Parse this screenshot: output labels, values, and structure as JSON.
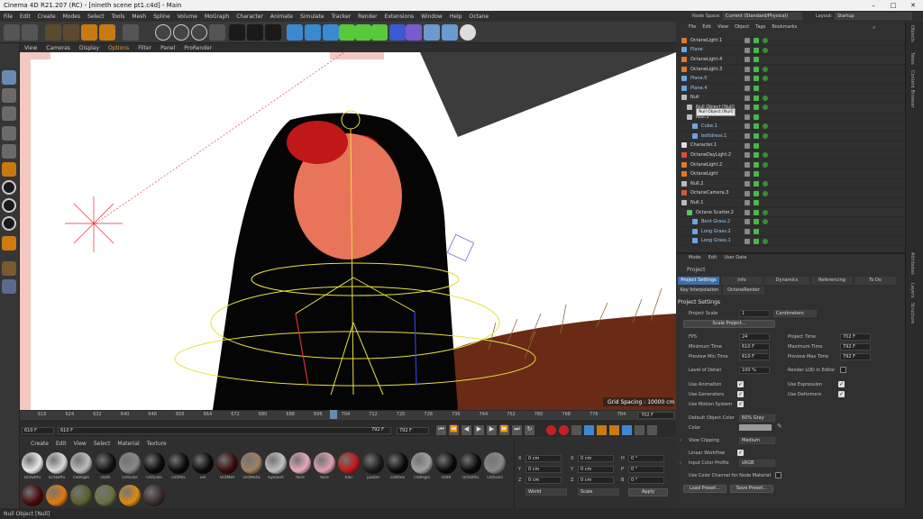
{
  "window": {
    "title": "Cinema 4D R21.207 (RC) - [nineth scene pt1.c4d] - Main"
  },
  "menubar": [
    "File",
    "Edit",
    "Create",
    "Modes",
    "Select",
    "Tools",
    "Mesh",
    "Spline",
    "Volume",
    "MoGraph",
    "Character",
    "Animate",
    "Simulate",
    "Tracker",
    "Render",
    "Extensions",
    "Window",
    "Help",
    "Octane"
  ],
  "nodespace": {
    "label": "Node Space:",
    "value": "Current (Standard/Physical)",
    "layout_label": "Layout:",
    "layout_value": "Startup"
  },
  "viewport_menu": [
    "View",
    "Cameras",
    "Display",
    "Options",
    "Filter",
    "Panel",
    "ProRender"
  ],
  "viewport": {
    "grid_spacing": "Grid Spacing : 10000 cm"
  },
  "timeline": {
    "ticks": [
      "616",
      "624",
      "632",
      "640",
      "648",
      "656",
      "664",
      "672",
      "680",
      "688",
      "696",
      "704",
      "712",
      "720",
      "728",
      "736",
      "744",
      "752",
      "760",
      "768",
      "776",
      "784",
      "792"
    ],
    "current": "702 F",
    "start": "610 F",
    "min": "610 F",
    "max": "792 F",
    "end": "792 F"
  },
  "object_manager": {
    "menu": [
      "File",
      "Edit",
      "View",
      "Object",
      "Tags",
      "Bookmarks"
    ],
    "rows": [
      {
        "name": "OctaneLight.1",
        "color": "#e07a2a"
      },
      {
        "name": "Plane",
        "color": "#6aa6e0"
      },
      {
        "name": "OctaneLight.4",
        "color": "#e07a2a"
      },
      {
        "name": "OctaneLight.3",
        "color": "#e07a2a"
      },
      {
        "name": "Plane.5",
        "color": "#6aa6e0"
      },
      {
        "name": "Plane.4",
        "color": "#6aa6e0"
      },
      {
        "name": "Null",
        "color": "#bbbbbb"
      },
      {
        "name": "Null Object [Null]",
        "color": "#bbbbbb"
      },
      {
        "name": "Null.3",
        "color": "#bbbbbb"
      },
      {
        "name": "Cube.1",
        "color": "#6aa6e0"
      },
      {
        "name": "bottdress.1",
        "color": "#6aa6e0"
      },
      {
        "name": "Character.1",
        "color": "#dddddd"
      },
      {
        "name": "OctaneDayLight.2",
        "color": "#e04a3a"
      },
      {
        "name": "OctaneLight.2",
        "color": "#e07a2a"
      },
      {
        "name": "OctaneLight",
        "color": "#e07a2a"
      },
      {
        "name": "Null.2",
        "color": "#bbbbbb"
      },
      {
        "name": "OctaneCamera.3",
        "color": "#d45a3a"
      },
      {
        "name": "Null.1",
        "color": "#bbbbbb"
      },
      {
        "name": "Octane Scatter.2",
        "color": "#5ac85a"
      },
      {
        "name": "Bent Grass.2",
        "color": "#6aa6e0"
      },
      {
        "name": "Long Grass.2",
        "color": "#6aa6e0"
      },
      {
        "name": "Long Grass.1",
        "color": "#6aa6e0"
      }
    ]
  },
  "attributes": {
    "menu": [
      "Mode",
      "Edit",
      "User Data"
    ],
    "header": "Project",
    "tabs": [
      "Project Settings",
      "Info",
      "Dynamics",
      "Referencing",
      "To Do"
    ],
    "subtabs": [
      "Key Interpolation",
      "OctaneRender"
    ],
    "section": "Project Settings",
    "project_scale_label": "Project Scale",
    "project_scale": "1",
    "project_scale_unit": "Centimeters",
    "scale_project_btn": "Scale Project...",
    "fps_label": "FPS",
    "fps": "24",
    "project_time_label": "Project Time",
    "project_time": "702 F",
    "min_time_label": "Minimum Time",
    "min_time": "610 F",
    "max_time_label": "Maximum Time",
    "max_time": "792 F",
    "pmin_label": "Preview Min Time",
    "pmin": "610 F",
    "pmax_label": "Preview Max Time",
    "pmax": "792 F",
    "lod_label": "Level of Detail",
    "lod": "100 %",
    "render_lod_label": "Render LOD in Editor",
    "use_anim": "Use Animation",
    "use_expr": "Use Expression",
    "use_gen": "Use Generators",
    "use_def": "Use Deformers",
    "use_motion": "Use Motion System",
    "default_color_label": "Default Object Color",
    "default_color": "60% Gray",
    "color_label": "Color",
    "view_clip_label": "View Clipping",
    "view_clip": "Medium",
    "linear_label": "Linear Workflow",
    "profile_label": "Input Color Profile",
    "profile": "sRGB",
    "color_channel_label": "Use Color Channel for Node Material",
    "load_preset": "Load Preset...",
    "save_preset": "Save Preset..."
  },
  "right_dock_tabs": [
    "Objects",
    "Takes",
    "Content Browser",
    "Attributes",
    "Layers",
    "Structure"
  ],
  "materials": {
    "menu": [
      "Create",
      "Edit",
      "View",
      "Select",
      "Material",
      "Texture"
    ],
    "row1": [
      {
        "label": "OctDiffu",
        "color": "#e8e8e8"
      },
      {
        "label": "OctDiffu",
        "color": "#d8d8d8"
      },
      {
        "label": "clothglo",
        "color": "#bdbdbd"
      },
      {
        "label": "cloth",
        "color": "#111111"
      },
      {
        "label": "OctGlos",
        "color": "#888888"
      },
      {
        "label": "OctGlos",
        "color": "#0a0a0a"
      },
      {
        "label": "OctMix",
        "color": "#0a0a0a"
      },
      {
        "label": "vel",
        "color": "#0a0a0a"
      },
      {
        "label": "OctMet",
        "color": "#3a0c0c"
      },
      {
        "label": "OctMeta",
        "color": "#a08060"
      },
      {
        "label": "eyelash",
        "color": "#c0c0c0"
      },
      {
        "label": "face",
        "color": "#e8a8b8"
      },
      {
        "label": "face",
        "color": "#e0a0b0"
      },
      {
        "label": "hair",
        "color": "#c01818"
      },
      {
        "label": "pastel",
        "color": "#1a1a1a"
      },
      {
        "label": "clothes",
        "color": "#0a0a0a"
      },
      {
        "label": "clothglo",
        "color": "#a0a0a0"
      },
      {
        "label": "cloth",
        "color": "#0a0a0a"
      },
      {
        "label": "OctDiffu",
        "color": "#0a0a0a"
      },
      {
        "label": "OctGlos",
        "color": "#888888"
      }
    ],
    "row2": [
      {
        "label": "",
        "color": "#4a0a0a"
      },
      {
        "label": "",
        "color": "#e07a10"
      },
      {
        "label": "",
        "color": "#5a6030"
      },
      {
        "label": "",
        "color": "#6a7040"
      },
      {
        "label": "",
        "color": "#e08a10"
      },
      {
        "label": "",
        "color": "#3a2a2a"
      }
    ]
  },
  "coords": {
    "x": "X",
    "y": "Y",
    "z": "Z",
    "h": "H",
    "p": "P",
    "b": "B",
    "val": "0 cm",
    "ang": "0 °",
    "world": "World",
    "scale": "Scale",
    "apply": "Apply"
  },
  "status": "Null Object [Null]",
  "tooltip": "Null Object [Null]"
}
